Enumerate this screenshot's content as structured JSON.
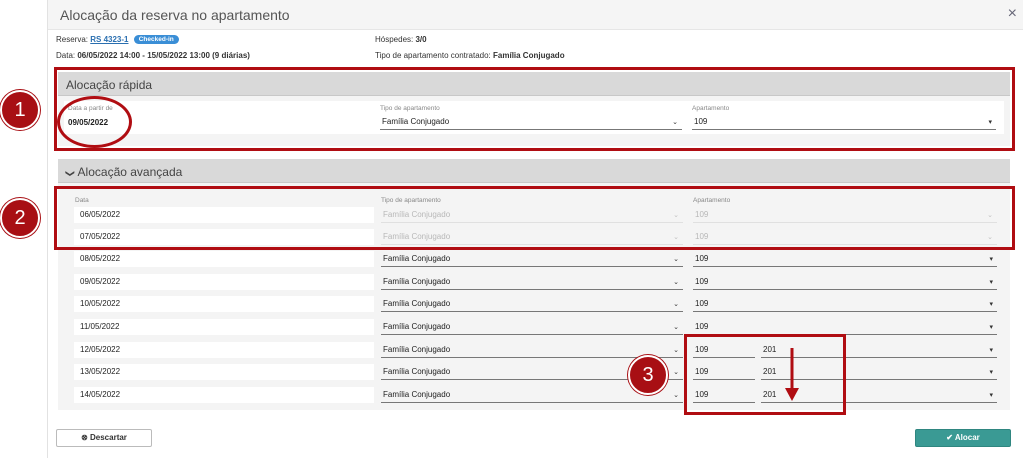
{
  "modal": {
    "title": "Alocação da reserva no apartamento",
    "close": "×"
  },
  "info": {
    "reserva_label": "Reserva:",
    "reserva_code": "RS 4323-1",
    "status_badge": "Checked-in",
    "data_label": "Data:",
    "data_value": "06/05/2022 14:00 - 15/05/2022 13:00 (9 diárias)",
    "hospedes_label": "Hóspedes:",
    "hospedes_value": "3/0",
    "tipo_label": "Tipo de apartamento contratado:",
    "tipo_value": "Família Conjugado"
  },
  "quick": {
    "title": "Alocação rápida",
    "date_label": "Data a partir de",
    "date_value": "09/05/2022",
    "type_label": "Tipo de apartamento",
    "type_value": "Família Conjugado",
    "apt_label": "Apartamento",
    "apt_value": "109"
  },
  "advanced": {
    "title": "Alocação avançada",
    "chevron": "❯",
    "col_date": "Data",
    "col_type": "Tipo de apartamento",
    "col_apt": "Apartamento",
    "rows": [
      {
        "date": "06/05/2022",
        "type": "Família Conjugado",
        "apt": "109",
        "apt2": "",
        "disabled": true
      },
      {
        "date": "07/05/2022",
        "type": "Família Conjugado",
        "apt": "109",
        "apt2": "",
        "disabled": true
      },
      {
        "date": "08/05/2022",
        "type": "Família Conjugado",
        "apt": "109",
        "apt2": "",
        "disabled": false
      },
      {
        "date": "09/05/2022",
        "type": "Família Conjugado",
        "apt": "109",
        "apt2": "",
        "disabled": false
      },
      {
        "date": "10/05/2022",
        "type": "Família Conjugado",
        "apt": "109",
        "apt2": "",
        "disabled": false
      },
      {
        "date": "11/05/2022",
        "type": "Família Conjugado",
        "apt": "109",
        "apt2": "",
        "disabled": false
      },
      {
        "date": "12/05/2022",
        "type": "Família Conjugado",
        "apt": "109",
        "apt2": "201",
        "disabled": false
      },
      {
        "date": "13/05/2022",
        "type": "Família Conjugado",
        "apt": "109",
        "apt2": "201",
        "disabled": false
      },
      {
        "date": "14/05/2022",
        "type": "Família Conjugado",
        "apt": "109",
        "apt2": "201",
        "disabled": false
      }
    ]
  },
  "annotations": {
    "one": "1",
    "two": "2",
    "three": "3",
    "color": "#b00d12"
  },
  "buttons": {
    "discard": "Descartar",
    "discard_icon": "times-circle-icon",
    "alocar": "Alocar",
    "alocar_icon": "check-circle-icon"
  },
  "colors": {
    "accent_button": "#3a9a94",
    "badge": "#3a8ed6",
    "link": "#2a6fb0"
  }
}
